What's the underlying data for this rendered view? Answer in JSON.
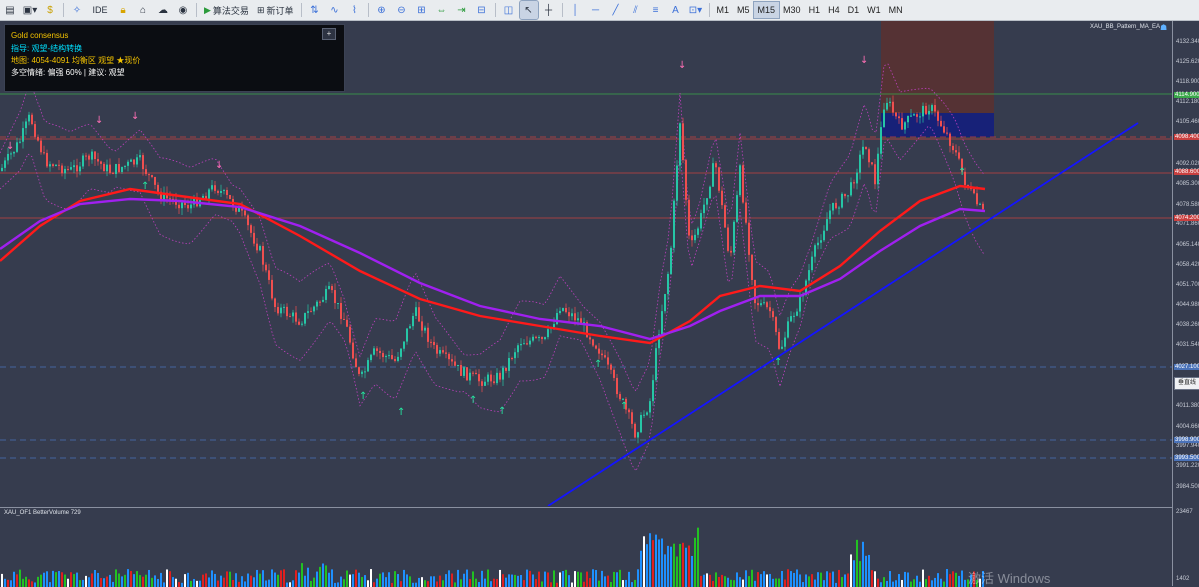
{
  "toolbar": {
    "algo_label": "算法交易",
    "new_order_label": "新订单",
    "ide_label": "IDE",
    "timeframes": [
      "M1",
      "M5",
      "M15",
      "M30",
      "H1",
      "H4",
      "D1",
      "W1",
      "MN"
    ],
    "active_timeframe": "M15"
  },
  "info_panel": {
    "title": "Gold consensus",
    "guide": "指导: 观望-结构转换",
    "zone": "地图: 4054-4091  均衡区  观望 ★现价",
    "bias": "多空情绪: 偏强 60% | 建议: 观望",
    "plus": "+"
  },
  "ea_label": "XAU_BB_Pattern_MA_EA",
  "sub_indicator": "XAU_OF1 BetterVolume 729",
  "price_axis": {
    "labels": [
      "4132.340",
      "4125.620",
      "4118.900",
      "4112.180",
      "4105.460",
      "4092.020",
      "4085.300",
      "4078.580",
      "4071.860",
      "4065.140",
      "4058.420",
      "4051.700",
      "4044.980",
      "4038.260",
      "4031.540",
      "4011.380",
      "4004.660",
      "3997.940",
      "3991.220",
      "3984.500"
    ],
    "tags": [
      {
        "text": "4114.900",
        "color": "#3aa84a"
      },
      {
        "text": "4098.400",
        "color": "#c94040"
      },
      {
        "text": "4088.600",
        "color": "#c94040"
      },
      {
        "text": "4074.200",
        "color": "#c94040"
      },
      {
        "text": "4027.100",
        "color": "#4a72b8"
      },
      {
        "text": "3998.900",
        "color": "#4a72b8"
      },
      {
        "text": "3993.500",
        "color": "#4a72b8"
      }
    ],
    "vertical_line_btn": "垂直线"
  },
  "vol_axis": {
    "top": "23467",
    "bottom": "1402"
  },
  "watermark": "激活 Windows",
  "colors": {
    "background": "#363c4e",
    "bull": "#26c6a6",
    "bear": "#ef4f4f",
    "ma_red": "#ff1a1a",
    "ma_purple": "#a020f0",
    "trend_blue": "#1414ff",
    "bb": "#c040c0"
  }
}
